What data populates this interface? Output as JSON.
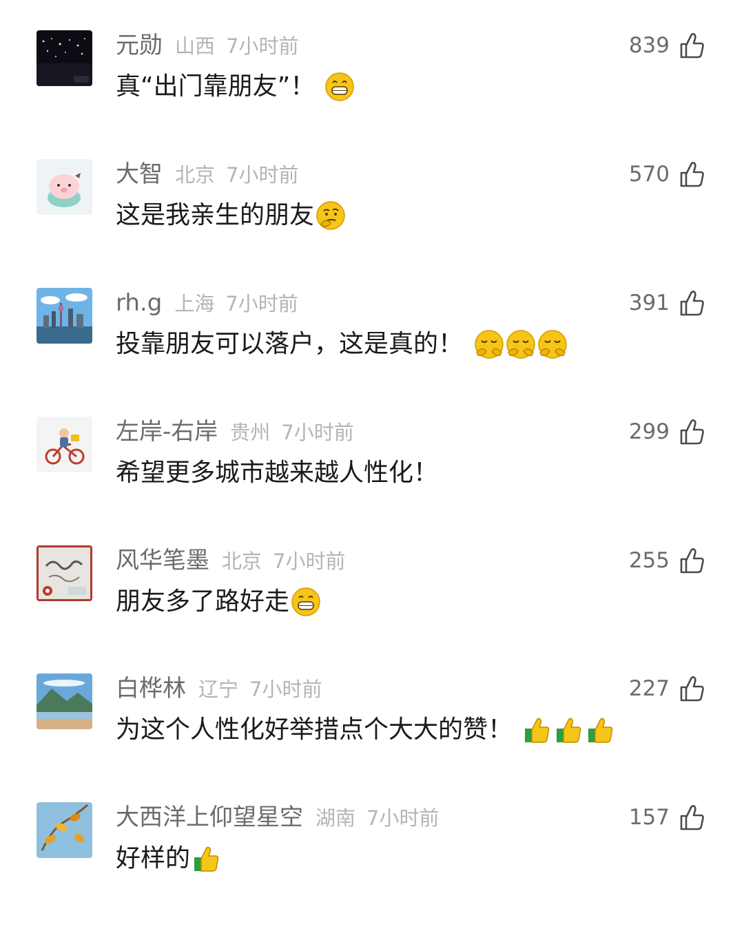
{
  "comments": [
    {
      "name": "元勋",
      "location": "山西",
      "time": "7小时前",
      "likes": "839",
      "text": "真“出门靠朋友”！",
      "avatar": "night-city-photo",
      "emojis": [
        "grin-emoji"
      ]
    },
    {
      "name": "大智",
      "location": "北京",
      "time": "7小时前",
      "likes": "570",
      "text": "这是我亲生的朋友",
      "avatar": "cartoon-pig",
      "emojis": [
        "thinking-emoji"
      ]
    },
    {
      "name": "rh.g",
      "location": "上海",
      "time": "7小时前",
      "likes": "391",
      "text": "投靠朋友可以落户，这是真的！",
      "avatar": "shanghai-skyline",
      "emojis": [
        "giggle-emoji",
        "giggle-emoji",
        "giggle-emoji"
      ]
    },
    {
      "name": "左岸-右岸",
      "location": "贵州",
      "time": "7小时前",
      "likes": "299",
      "text": "希望更多城市越来越人性化！",
      "avatar": "cartoon-bicycle",
      "emojis": []
    },
    {
      "name": "风华笔墨",
      "location": "北京",
      "time": "7小时前",
      "likes": "255",
      "text": "朋友多了路好走",
      "avatar": "calligraphy-art",
      "emojis": [
        "grin-emoji"
      ]
    },
    {
      "name": "白桦林",
      "location": "辽宁",
      "time": "7小时前",
      "likes": "227",
      "text": "为这个人性化好举措点个大大的赞！",
      "avatar": "seaside-landscape",
      "emojis": [
        "thumbs-up-emoji",
        "thumbs-up-emoji",
        "thumbs-up-emoji"
      ]
    },
    {
      "name": "大西洋上仰望星空",
      "location": "湖南",
      "time": "7小时前",
      "likes": "157",
      "text": "好样的",
      "avatar": "autumn-leaves",
      "emojis": [
        "thumbs-up-emoji"
      ]
    }
  ],
  "colors": {
    "name": "#6b6b6b",
    "meta": "#b4b4b4",
    "text": "#1a1a1a",
    "emoji_yellow": "#f5c518"
  }
}
